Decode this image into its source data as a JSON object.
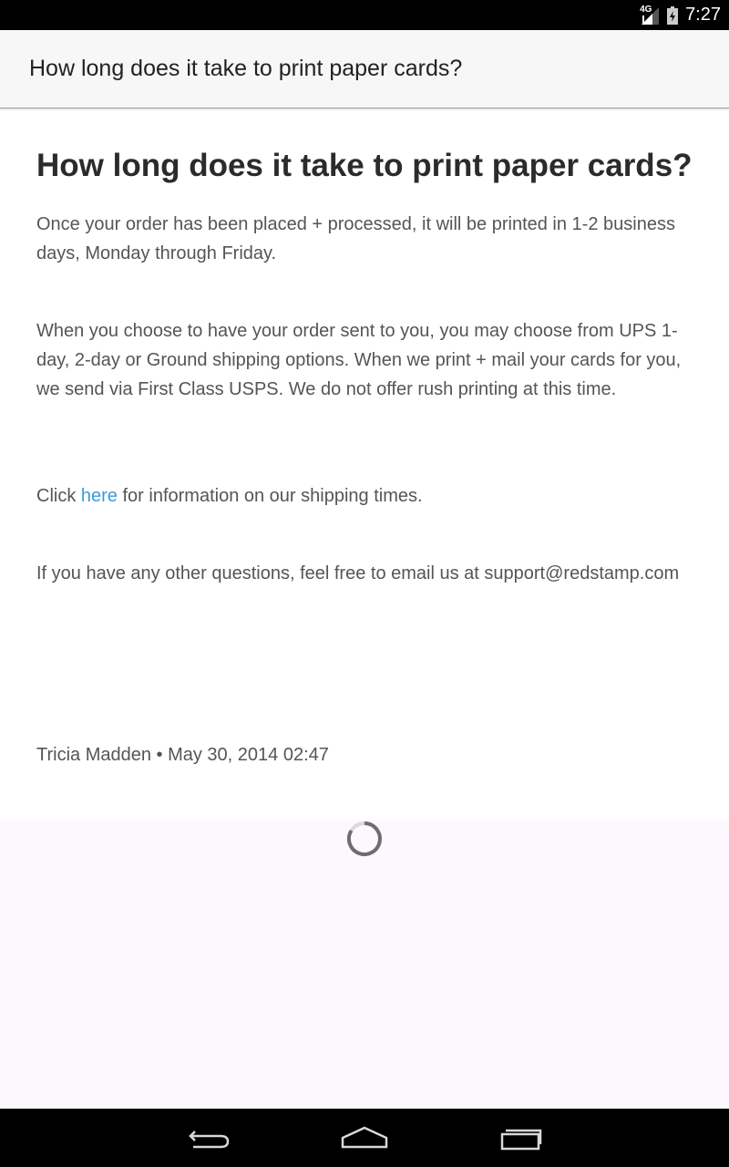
{
  "status_bar": {
    "network": "4G",
    "time": "7:27"
  },
  "action_bar": {
    "title": "How long does it take to print paper cards?"
  },
  "article": {
    "title": "How long does it take to print paper cards?",
    "paragraph1": "Once your order has been placed + processed, it will be printed in 1-2 business days, Monday through Friday.",
    "paragraph2": "When you choose to have your order sent to you, you may choose from UPS 1-day, 2-day or Ground shipping options. When we print + mail your cards for you, we send via First Class USPS. We do not offer rush printing at this time.",
    "paragraph3_before": "Click ",
    "paragraph3_link": "here",
    "paragraph3_after": " for information on our shipping times.",
    "paragraph4": "If you have any other questions, feel free to email us at support@redstamp.com",
    "meta": "Tricia Madden • May 30, 2014 02:47"
  },
  "nav_bar": {
    "back_icon": "back-icon",
    "home_icon": "home-icon",
    "recents_icon": "recents-icon"
  },
  "colors": {
    "link": "#3b9bd8",
    "body_text": "#555555",
    "title_text": "#2b2b2b",
    "loading_bg": "#fdf8fd"
  }
}
